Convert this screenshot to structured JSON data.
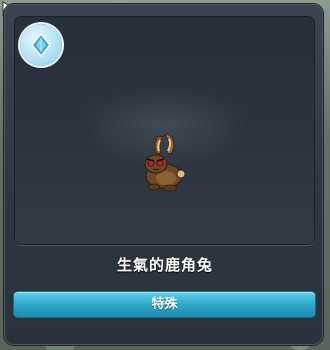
{
  "monster": {
    "name": "生氣的鹿角兔"
  },
  "actions": {
    "primary_label": "特殊"
  },
  "badge": {
    "icon": "diamond-gem-icon",
    "color": "#8ccbe6"
  },
  "colors": {
    "button": "#2fa7c9",
    "panel": "#2d3640"
  }
}
